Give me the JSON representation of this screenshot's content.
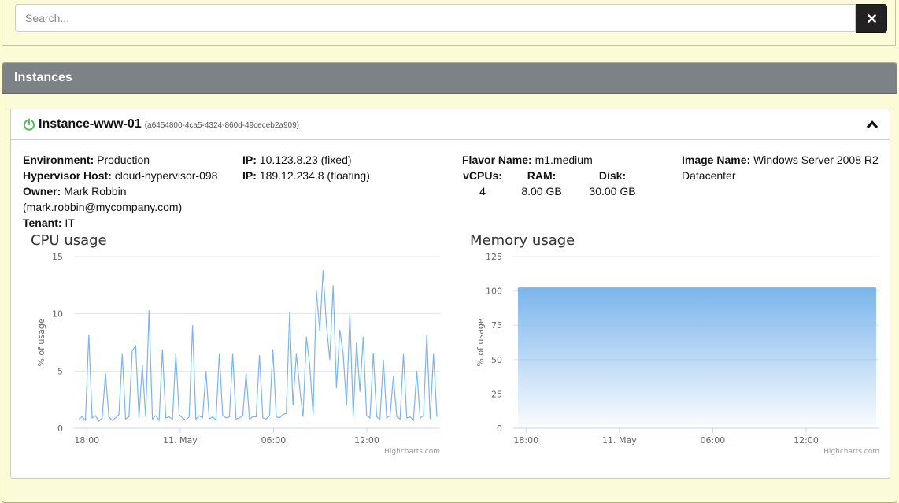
{
  "search": {
    "placeholder": "Search...",
    "clear_icon": "close-icon"
  },
  "panel": {
    "title": "Instances"
  },
  "instance": {
    "status_icon": "power-icon",
    "status_color": "#5cb85c",
    "name": "Instance-www-01",
    "id": "(a6454800-4ca5-4324-860d-49ceceb2a909)",
    "collapse_icon": "chevron-up-icon",
    "environment_label": "Environment:",
    "environment": "Production",
    "hypervisor_label": "Hypervisor Host:",
    "hypervisor": "cloud-hypervisor-098",
    "owner_label": "Owner:",
    "owner": "Mark Robbin",
    "owner_email": "(mark.robbin@mycompany.com)",
    "tenant_label": "Tenant:",
    "tenant": "IT",
    "ip_label": "IP:",
    "ip_fixed": "10.123.8.23 (fixed)",
    "ip_floating": "189.12.234.8 (floating)",
    "flavor_label": "Flavor Name:",
    "flavor": "m1.medium",
    "vcpus_label": "vCPUs:",
    "vcpus": "4",
    "ram_label": "RAM:",
    "ram": "8.00 GB",
    "disk_label": "Disk:",
    "disk": "30.00 GB",
    "image_label": "Image Name:",
    "image": "Windows Server 2008 R2 Datacenter"
  },
  "chart_data": [
    {
      "type": "line",
      "title": "CPU usage",
      "ylabel": "% of usage",
      "ylim": [
        0,
        15
      ],
      "yticks": [
        0,
        5,
        10,
        15
      ],
      "xticks": [
        "18:00",
        "11. May",
        "06:00",
        "12:00"
      ],
      "credits": "Highcharts.com",
      "color": "#7cb5ec",
      "series": [
        {
          "values": [
            0.8,
            1.0,
            0.7,
            8.2,
            0.9,
            1.1,
            0.6,
            0.9,
            4.8,
            1.0,
            0.7,
            0.9,
            1.2,
            6.5,
            0.8,
            1.0,
            6.8,
            7.2,
            0.9,
            5.5,
            1.0,
            10.3,
            0.8,
            1.1,
            0.7,
            6.9,
            0.9,
            1.0,
            0.8,
            6.5,
            1.2,
            0.9,
            0.7,
            1.0,
            9.0,
            0.8,
            1.1,
            0.9,
            5.0,
            0.8,
            1.0,
            0.7,
            6.5,
            1.1,
            0.9,
            1.0,
            6.5,
            0.8,
            0.9,
            1.1,
            4.8,
            0.8,
            1.0,
            1.0,
            6.4,
            0.9,
            0.8,
            1.1,
            6.9,
            1.0,
            0.9,
            1.2,
            1.3,
            10.2,
            2.0,
            6.5,
            3.5,
            1.0,
            8.0,
            5.5,
            1.2,
            12.0,
            8.5,
            13.8,
            9.0,
            6.0,
            12.5,
            3.5,
            8.6,
            6.5,
            2.0,
            10.0,
            1.0,
            7.5,
            3.2,
            8.0,
            1.1,
            0.9,
            6.6,
            1.0,
            0.8,
            6.0,
            0.9,
            1.1,
            4.5,
            1.0,
            0.8,
            6.5,
            0.9,
            1.0,
            0.7,
            5.0,
            0.9,
            1.1,
            8.2,
            0.8,
            6.5,
            1.0
          ]
        }
      ]
    },
    {
      "type": "area",
      "title": "Memory usage",
      "ylabel": "% of usage",
      "ylim": [
        0,
        125
      ],
      "yticks": [
        0,
        25,
        50,
        75,
        100,
        125
      ],
      "xticks": [
        "18:00",
        "11. May",
        "06:00",
        "12:00"
      ],
      "credits": "Highcharts.com",
      "color": "#7cb5ec",
      "series": [
        {
          "values": [
            102,
            102,
            102,
            102,
            102,
            102,
            102,
            102,
            102,
            102
          ]
        }
      ]
    }
  ]
}
